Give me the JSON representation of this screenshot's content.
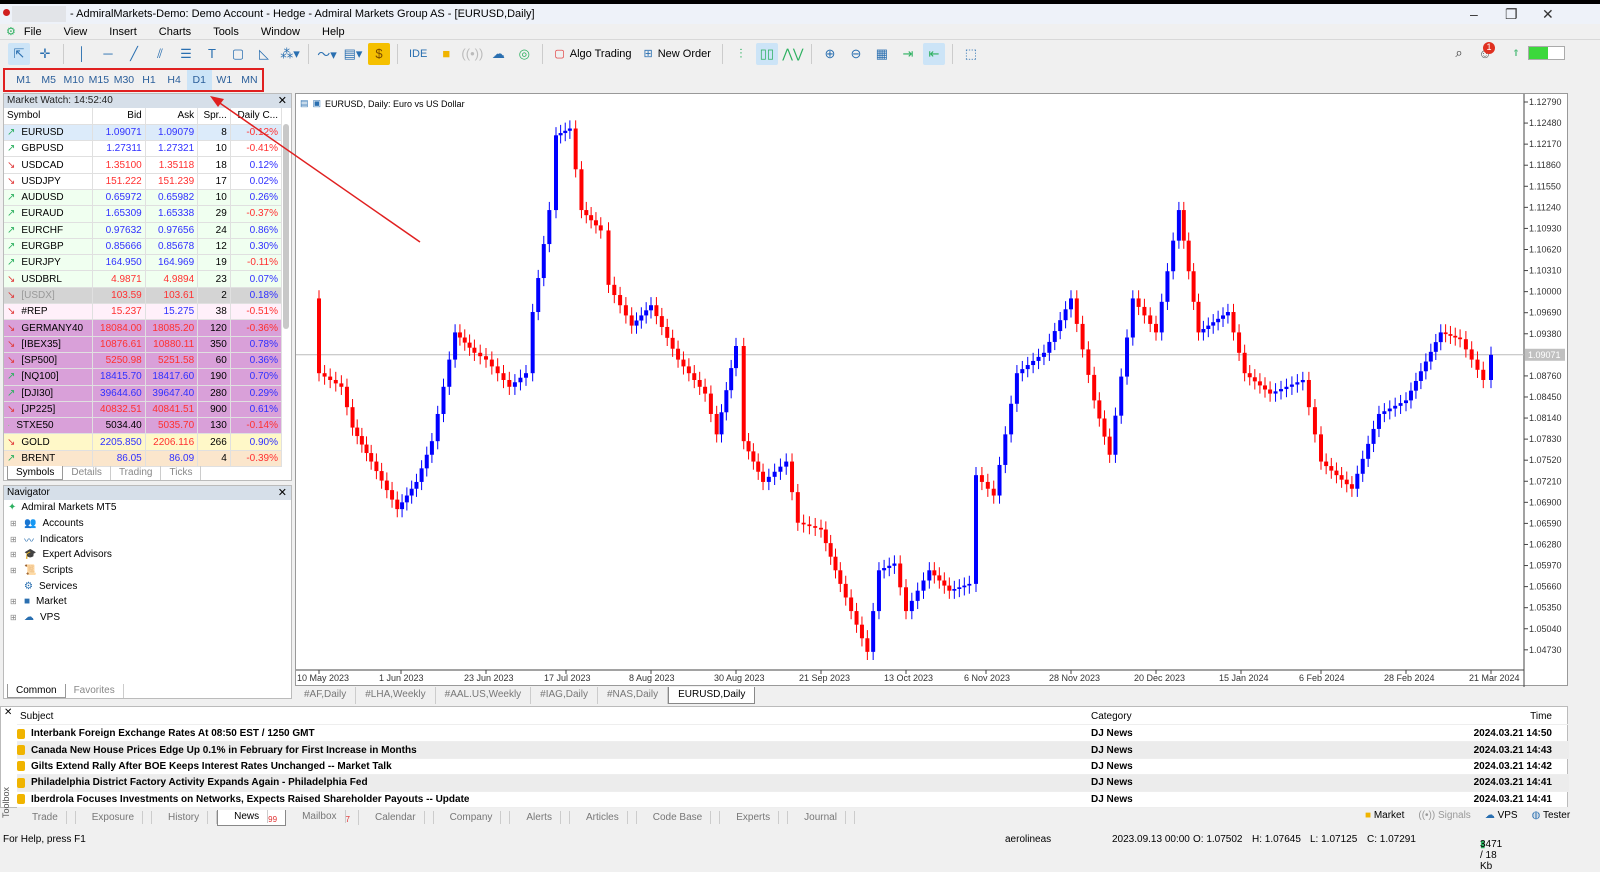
{
  "window": {
    "title": "- AdmiralMarkets-Demo: Demo Account - Hedge - Admiral Markets Group AS - [EURUSD,Daily]"
  },
  "menu": [
    "File",
    "View",
    "Insert",
    "Charts",
    "Tools",
    "Window",
    "Help"
  ],
  "toolbar": {
    "ide": "IDE",
    "algo_trading": "Algo Trading",
    "new_order": "New Order",
    "notification_count": "1"
  },
  "timeframes": [
    "M1",
    "M5",
    "M10",
    "M15",
    "M30",
    "H1",
    "H4",
    "D1",
    "W1",
    "MN"
  ],
  "active_timeframe": "D1",
  "market_watch": {
    "title": "Market Watch: 14:52:40",
    "columns": [
      "Symbol",
      "Bid",
      "Ask",
      "Spr...",
      "Daily C..."
    ],
    "rows": [
      {
        "sym": "EURUSD",
        "dir": "up",
        "bid": "1.09071",
        "ask": "1.09079",
        "spr": "8",
        "chg": "-0.12%",
        "bg": "#dcebfa",
        "bc": "bl",
        "ac": "bl"
      },
      {
        "sym": "GBPUSD",
        "dir": "up",
        "bid": "1.27311",
        "ask": "1.27321",
        "spr": "10",
        "chg": "-0.41%",
        "bg": "#ffffff",
        "bc": "bl",
        "ac": "bl"
      },
      {
        "sym": "USDCAD",
        "dir": "dn",
        "bid": "1.35100",
        "ask": "1.35118",
        "spr": "18",
        "chg": "0.12%",
        "bg": "#ffffff",
        "bc": "rd",
        "ac": "rd"
      },
      {
        "sym": "USDJPY",
        "dir": "dn",
        "bid": "151.222",
        "ask": "151.239",
        "spr": "17",
        "chg": "0.02%",
        "bg": "#ffffff",
        "bc": "rd",
        "ac": "rd"
      },
      {
        "sym": "AUDUSD",
        "dir": "up",
        "bid": "0.65972",
        "ask": "0.65982",
        "spr": "10",
        "chg": "0.26%",
        "bg": "#f0fff0",
        "bc": "bl",
        "ac": "bl"
      },
      {
        "sym": "EURAUD",
        "dir": "up",
        "bid": "1.65309",
        "ask": "1.65338",
        "spr": "29",
        "chg": "-0.37%",
        "bg": "#f0fff0",
        "bc": "bl",
        "ac": "bl"
      },
      {
        "sym": "EURCHF",
        "dir": "up",
        "bid": "0.97632",
        "ask": "0.97656",
        "spr": "24",
        "chg": "0.86%",
        "bg": "#f0fff0",
        "bc": "bl",
        "ac": "bl"
      },
      {
        "sym": "EURGBP",
        "dir": "up",
        "bid": "0.85666",
        "ask": "0.85678",
        "spr": "12",
        "chg": "0.30%",
        "bg": "#f0fff0",
        "bc": "bl",
        "ac": "bl"
      },
      {
        "sym": "EURJPY",
        "dir": "up",
        "bid": "164.950",
        "ask": "164.969",
        "spr": "19",
        "chg": "-0.11%",
        "bg": "#f0fff0",
        "bc": "bl",
        "ac": "bl"
      },
      {
        "sym": "USDBRL",
        "dir": "dn",
        "bid": "4.9871",
        "ask": "4.9894",
        "spr": "23",
        "chg": "0.07%",
        "bg": "#f0fff0",
        "bc": "rd",
        "ac": "rd"
      },
      {
        "sym": "[USDX]",
        "dir": "dn",
        "bid": "103.59",
        "ask": "103.61",
        "spr": "2",
        "chg": "0.18%",
        "bg": "#d4d4d4",
        "bc": "rd",
        "ac": "rd",
        "muted": true
      },
      {
        "sym": "#REP",
        "dir": "dn",
        "bid": "15.237",
        "ask": "15.275",
        "spr": "38",
        "chg": "-0.51%",
        "bg": "#fff0fa",
        "bc": "rd",
        "ac": "bl"
      },
      {
        "sym": "GERMANY40",
        "dir": "dn",
        "bid": "18084.00",
        "ask": "18085.20",
        "spr": "120",
        "chg": "-0.36%",
        "bg": "#d9a0d9",
        "bc": "rd",
        "ac": "rd"
      },
      {
        "sym": "[IBEX35]",
        "dir": "dn",
        "bid": "10876.61",
        "ask": "10880.11",
        "spr": "350",
        "chg": "0.78%",
        "bg": "#d9a0d9",
        "bc": "rd",
        "ac": "rd"
      },
      {
        "sym": "[SP500]",
        "dir": "dn",
        "bid": "5250.98",
        "ask": "5251.58",
        "spr": "60",
        "chg": "0.36%",
        "bg": "#d9a0d9",
        "bc": "rd",
        "ac": "rd"
      },
      {
        "sym": "[NQ100]",
        "dir": "up",
        "bid": "18415.70",
        "ask": "18417.60",
        "spr": "190",
        "chg": "0.70%",
        "bg": "#d9a0d9",
        "bc": "bl",
        "ac": "bl"
      },
      {
        "sym": "[DJI30]",
        "dir": "up",
        "bid": "39644.60",
        "ask": "39647.40",
        "spr": "280",
        "chg": "0.29%",
        "bg": "#d9a0d9",
        "bc": "bl",
        "ac": "bl"
      },
      {
        "sym": "[JP225]",
        "dir": "dn",
        "bid": "40832.51",
        "ask": "40841.51",
        "spr": "900",
        "chg": "0.61%",
        "bg": "#d9a0d9",
        "bc": "rd",
        "ac": "rd"
      },
      {
        "sym": "STXE50",
        "dir": "eq",
        "bid": "5034.40",
        "ask": "5035.70",
        "spr": "130",
        "chg": "-0.14%",
        "bg": "#d9a0d9",
        "bc": "",
        "ac": "rd"
      },
      {
        "sym": "GOLD",
        "dir": "dn",
        "bid": "2205.850",
        "ask": "2206.116",
        "spr": "266",
        "chg": "0.90%",
        "bg": "#fff8c8",
        "bc": "bl",
        "ac": "rd"
      },
      {
        "sym": "BRENT",
        "dir": "up",
        "bid": "86.05",
        "ask": "86.09",
        "spr": "4",
        "chg": "-0.39%",
        "bg": "#fbe6cc",
        "bc": "bl",
        "ac": "bl"
      }
    ],
    "tabs": [
      "Symbols",
      "Details",
      "Trading",
      "Ticks"
    ]
  },
  "navigator": {
    "title": "Navigator",
    "root": "Admiral Markets MT5",
    "items": [
      "Accounts",
      "Indicators",
      "Expert Advisors",
      "Scripts",
      "Services",
      "Market",
      "VPS"
    ],
    "tabs": [
      "Common",
      "Favorites"
    ]
  },
  "chart": {
    "label": "EURUSD, Daily:  Euro vs US Dollar",
    "tabs": [
      "#AF,Daily",
      "#LHA,Weekly",
      "#AAL.US,Weekly",
      "#IAG,Daily",
      "#NAS,Daily",
      "EURUSD,Daily"
    ],
    "active_tab": "EURUSD,Daily"
  },
  "chart_data": {
    "type": "candlestick",
    "symbol": "EURUSD",
    "timeframe": "Daily",
    "current_price": "1.09071",
    "y_ticks": [
      "1.12790",
      "1.12480",
      "1.12170",
      "1.11860",
      "1.11550",
      "1.11240",
      "1.10930",
      "1.10620",
      "1.10310",
      "1.10000",
      "1.09690",
      "1.09380",
      "1.08760",
      "1.08450",
      "1.08140",
      "1.07830",
      "1.07520",
      "1.07210",
      "1.06900",
      "1.06590",
      "1.06280",
      "1.05970",
      "1.05660",
      "1.05350",
      "1.05040",
      "1.04730"
    ],
    "ylim": [
      1.0445,
      1.1295
    ],
    "x_ticks": [
      [
        "10 May 2023",
        "2023-05-10"
      ],
      [
        "1 Jun 2023",
        "2023-06-01"
      ],
      [
        "23 Jun 2023",
        "2023-06-23"
      ],
      [
        "17 Jul 2023",
        "2023-07-17"
      ],
      [
        "8 Aug 2023",
        "2023-08-08"
      ],
      [
        "30 Aug 2023",
        "2023-08-30"
      ],
      [
        "21 Sep 2023",
        "2023-09-21"
      ],
      [
        "13 Oct 2023",
        "2023-10-13"
      ],
      [
        "6 Nov 2023",
        "2023-11-06"
      ],
      [
        "28 Nov 2023",
        "2023-11-28"
      ],
      [
        "20 Dec 2023",
        "2023-12-20"
      ],
      [
        "15 Jan 2024",
        "2024-01-15"
      ],
      [
        "6 Feb 2024",
        "2024-02-06"
      ],
      [
        "28 Feb 2024",
        "2024-02-28"
      ],
      [
        "21 Mar 2024",
        "2024-03-21"
      ]
    ],
    "closes": [
      [
        "2023-05-08",
        1.099
      ],
      [
        "2023-05-10",
        1.088
      ],
      [
        "2023-05-16",
        1.086
      ],
      [
        "2023-05-19",
        1.08
      ],
      [
        "2023-05-24",
        1.075
      ],
      [
        "2023-05-31",
        1.068
      ],
      [
        "2023-06-05",
        1.072
      ],
      [
        "2023-06-09",
        1.078
      ],
      [
        "2023-06-15",
        1.094
      ],
      [
        "2023-06-20",
        1.091
      ],
      [
        "2023-06-23",
        1.09
      ],
      [
        "2023-06-30",
        1.086
      ],
      [
        "2023-07-05",
        1.088
      ],
      [
        "2023-07-07",
        1.097
      ],
      [
        "2023-07-12",
        1.112
      ],
      [
        "2023-07-14",
        1.123
      ],
      [
        "2023-07-18",
        1.124
      ],
      [
        "2023-07-21",
        1.112
      ],
      [
        "2023-07-26",
        1.109
      ],
      [
        "2023-07-28",
        1.101
      ],
      [
        "2023-08-03",
        1.095
      ],
      [
        "2023-08-08",
        1.098
      ],
      [
        "2023-08-15",
        1.09
      ],
      [
        "2023-08-22",
        1.085
      ],
      [
        "2023-08-25",
        1.079
      ],
      [
        "2023-08-30",
        1.092
      ],
      [
        "2023-09-01",
        1.078
      ],
      [
        "2023-09-06",
        1.072
      ],
      [
        "2023-09-12",
        1.075
      ],
      [
        "2023-09-15",
        1.066
      ],
      [
        "2023-09-21",
        1.065
      ],
      [
        "2023-09-26",
        1.057
      ],
      [
        "2023-10-03",
        1.047
      ],
      [
        "2023-10-06",
        1.059
      ],
      [
        "2023-10-10",
        1.06
      ],
      [
        "2023-10-13",
        1.053
      ],
      [
        "2023-10-20",
        1.059
      ],
      [
        "2023-10-26",
        1.056
      ],
      [
        "2023-11-01",
        1.057
      ],
      [
        "2023-11-03",
        1.073
      ],
      [
        "2023-11-08",
        1.07
      ],
      [
        "2023-11-14",
        1.088
      ],
      [
        "2023-11-21",
        1.091
      ],
      [
        "2023-11-28",
        1.099
      ],
      [
        "2023-12-04",
        1.084
      ],
      [
        "2023-12-08",
        1.076
      ],
      [
        "2023-12-14",
        1.099
      ],
      [
        "2023-12-20",
        1.094
      ],
      [
        "2023-12-27",
        1.112
      ],
      [
        "2024-01-02",
        1.094
      ],
      [
        "2024-01-11",
        1.097
      ],
      [
        "2024-01-16",
        1.088
      ],
      [
        "2024-01-23",
        1.085
      ],
      [
        "2024-02-01",
        1.087
      ],
      [
        "2024-02-06",
        1.075
      ],
      [
        "2024-02-14",
        1.071
      ],
      [
        "2024-02-21",
        1.082
      ],
      [
        "2024-02-28",
        1.084
      ],
      [
        "2024-03-08",
        1.094
      ],
      [
        "2024-03-13",
        1.093
      ],
      [
        "2024-03-19",
        1.087
      ],
      [
        "2024-03-21",
        1.0907
      ]
    ],
    "colors": {
      "bull": "#0000ff",
      "bear": "#ff0000"
    }
  },
  "toolbox": {
    "label": "Toolbox",
    "columns": [
      "Subject",
      "Category",
      "Time"
    ],
    "news": [
      [
        "Interbank Foreign Exchange Rates At 08:50 EST / 1250 GMT",
        "DJ News",
        "2024.03.21 14:50"
      ],
      [
        "Canada New House Prices Edge Up 0.1% in February for First Increase in Months",
        "DJ News",
        "2024.03.21 14:43"
      ],
      [
        "Gilts Extend Rally After BOE Keeps Interest Rates Unchanged -- Market Talk",
        "DJ News",
        "2024.03.21 14:42"
      ],
      [
        "Philadelphia District Factory Activity Expands Again - Philadelphia Fed",
        "DJ News",
        "2024.03.21 14:41"
      ],
      [
        "Iberdrola Focuses Investments on Networks, Expects Raised Shareholder Payouts -- Update",
        "DJ News",
        "2024.03.21 14:41"
      ]
    ],
    "tabs": [
      "Trade",
      "Exposure",
      "History",
      "News",
      "Mailbox",
      "Calendar",
      "Company",
      "Alerts",
      "Articles",
      "Code Base",
      "Experts",
      "Journal"
    ],
    "news_count": "99",
    "mail_count": "7",
    "right": [
      "Market",
      "Signals",
      "VPS",
      "Tester"
    ]
  },
  "status": {
    "help": "For Help, press F1",
    "profile": "aerolineas",
    "time": "2023.09.13 00:00",
    "o": "O: 1.07502",
    "h": "H: 1.07645",
    "l": "L: 1.07125",
    "c": "C: 1.07291",
    "net": "3471 / 18 Kb"
  }
}
